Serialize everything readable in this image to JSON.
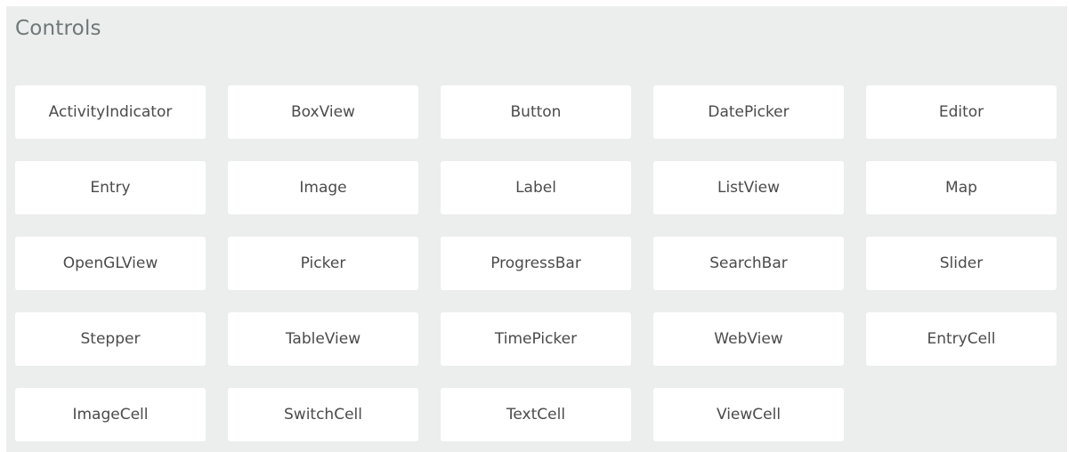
{
  "panel": {
    "title": "Controls"
  },
  "controls": [
    "ActivityIndicator",
    "BoxView",
    "Button",
    "DatePicker",
    "Editor",
    "Entry",
    "Image",
    "Label",
    "ListView",
    "Map",
    "OpenGLView",
    "Picker",
    "ProgressBar",
    "SearchBar",
    "Slider",
    "Stepper",
    "TableView",
    "TimePicker",
    "WebView",
    "EntryCell",
    "ImageCell",
    "SwitchCell",
    "TextCell",
    "ViewCell"
  ]
}
